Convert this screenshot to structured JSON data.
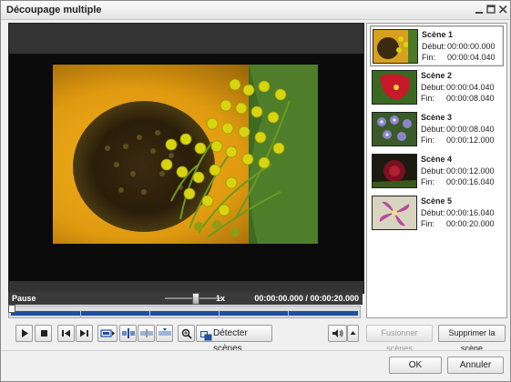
{
  "window": {
    "title": "Découpage multiple",
    "controls": [
      "minimize-icon",
      "maximize-icon",
      "close-icon"
    ]
  },
  "player": {
    "status": "Pause",
    "speed_label": "1x",
    "speed_level": 0.6,
    "current_time": "00:00:00.000",
    "separator": "/",
    "total_time": "00:00:20.000",
    "timeline_progress": 0
  },
  "toolbar": {
    "icons": [
      "play-icon",
      "stop-icon",
      "prev-frame-icon",
      "next-frame-icon",
      "frame-step-icon",
      "split-icon",
      "merge-icon",
      "delete-marker-icon",
      "zoom-icon",
      "volume-icon",
      "volume-arrow-icon"
    ],
    "detect_label": "Détecter scènes"
  },
  "scenes": [
    {
      "name": "Scène 1",
      "start_label": "Début:",
      "start": "00:00:00.000",
      "end_label": "Fin:",
      "end": "00:00:04.040",
      "thumb_color": "#d8a020"
    },
    {
      "name": "Scène 2",
      "start_label": "Début:",
      "start": "00:00:04.040",
      "end_label": "Fin:",
      "end": "00:00:08.040",
      "thumb_color": "#c61a2a"
    },
    {
      "name": "Scène 3",
      "start_label": "Début:",
      "start": "00:00:08.040",
      "end_label": "Fin:",
      "end": "00:00:12.000",
      "thumb_color": "#8a87c8"
    },
    {
      "name": "Scène 4",
      "start_label": "Début:",
      "start": "00:00:12.000",
      "end_label": "Fin:",
      "end": "00:00:16.040",
      "thumb_color": "#7a1020"
    },
    {
      "name": "Scène 5",
      "start_label": "Début:",
      "start": "00:00:16.040",
      "end_label": "Fin:",
      "end": "00:00:20.000",
      "thumb_color": "#b84a9a"
    }
  ],
  "actions": {
    "merge": "Fusionner scènes",
    "delete": "Supprimer la scène"
  },
  "dialog": {
    "ok": "OK",
    "cancel": "Annuler"
  },
  "colors": {
    "timeline": "#1f4f9e",
    "video_bg": "#333333"
  }
}
